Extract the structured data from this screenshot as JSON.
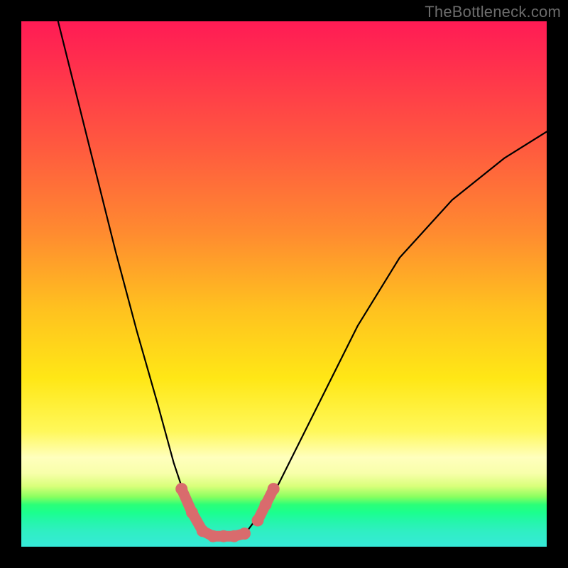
{
  "watermark": "TheBottleneck.com",
  "chart_data": {
    "type": "line",
    "title": "",
    "xlabel": "",
    "ylabel": "",
    "xlim": [
      0,
      100
    ],
    "ylim": [
      0,
      100
    ],
    "grid": false,
    "legend": false,
    "annotations": [],
    "series": [
      {
        "name": "curve-left",
        "x": [
          7,
          10,
          14,
          18,
          22,
          26,
          29,
          31,
          33,
          35
        ],
        "y": [
          100,
          88,
          72,
          56,
          41,
          27,
          16,
          10,
          6,
          3
        ]
      },
      {
        "name": "valley-floor",
        "x": [
          35,
          37,
          39,
          41,
          43
        ],
        "y": [
          3,
          2,
          2,
          2,
          3
        ]
      },
      {
        "name": "curve-right",
        "x": [
          43,
          46,
          49,
          53,
          58,
          64,
          72,
          82,
          92,
          100
        ],
        "y": [
          3,
          7,
          12,
          20,
          30,
          42,
          55,
          66,
          74,
          79
        ]
      }
    ],
    "markers": [
      {
        "name": "left-valley-run",
        "x": [
          30.5,
          32.5,
          34.5,
          36.5,
          38.5,
          40.5,
          42.5
        ],
        "y": [
          11,
          6.5,
          3,
          2,
          2,
          2,
          2.5
        ]
      },
      {
        "name": "right-valley-run",
        "x": [
          45,
          46.5,
          48
        ],
        "y": [
          5,
          8,
          11
        ]
      }
    ],
    "colors": {
      "curve": "#000000",
      "marker": "#d96b6d",
      "gradient_top": "#ff1b55",
      "gradient_mid": "#ffe716",
      "gradient_green": "#1bff8e"
    }
  }
}
